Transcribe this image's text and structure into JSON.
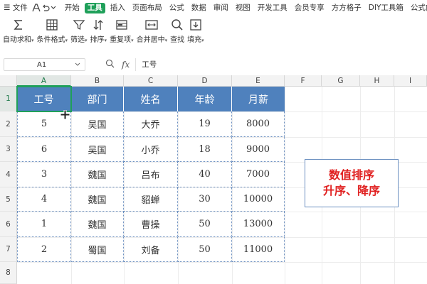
{
  "menubar": {
    "hamburger": "☰",
    "file_label": "文件",
    "items": [
      "开始",
      "工具",
      "插入",
      "页面布局",
      "公式",
      "数据",
      "审阅",
      "视图",
      "开发工具",
      "会员专享",
      "方方格子",
      "DIY工具箱",
      "公式向导"
    ],
    "active_index": 1
  },
  "ribbon": {
    "buttons": [
      {
        "label": "自动求和",
        "caret": "▾",
        "icon": "sigma-icon"
      },
      {
        "label": "条件格式",
        "caret": "▾",
        "icon": "grid-icon"
      },
      {
        "label": "筛选",
        "caret": "▾",
        "icon": "filter-icon"
      },
      {
        "label": "排序",
        "caret": "▾",
        "icon": "sort-icon"
      },
      {
        "label": "重复项",
        "caret": "▾",
        "icon": "duplicate-icon"
      },
      {
        "label": "合并居中",
        "caret": "▾",
        "icon": "merge-icon"
      },
      {
        "label": "查找",
        "caret": "",
        "icon": "search-icon"
      },
      {
        "label": "填充",
        "caret": "▾",
        "icon": "fill-icon"
      }
    ]
  },
  "formula_bar": {
    "name_box": "A1",
    "fx": "fx",
    "content": "工号"
  },
  "grid": {
    "columns": [
      "A",
      "B",
      "C",
      "D",
      "E",
      "F",
      "G",
      "H",
      "I"
    ],
    "rows": [
      "1",
      "2",
      "3",
      "4",
      "5",
      "6",
      "7",
      "8"
    ],
    "selected_col": "A",
    "selected_row": "1"
  },
  "table": {
    "headers": [
      "工号",
      "部门",
      "姓名",
      "年龄",
      "月薪"
    ],
    "rows": [
      [
        "5",
        "吴国",
        "大乔",
        "19",
        "8000"
      ],
      [
        "6",
        "吴国",
        "小乔",
        "18",
        "9000"
      ],
      [
        "3",
        "魏国",
        "吕布",
        "40",
        "7000"
      ],
      [
        "4",
        "魏国",
        "貂蝉",
        "30",
        "10000"
      ],
      [
        "1",
        "魏国",
        "曹操",
        "50",
        "13000"
      ],
      [
        "2",
        "蜀国",
        "刘备",
        "50",
        "11000"
      ]
    ]
  },
  "note": {
    "line1": "数值排序",
    "line2": "升序、降序"
  },
  "colors": {
    "accent": "#1fa05a",
    "header_fill": "#4f81bd",
    "note_text": "#e02020"
  }
}
